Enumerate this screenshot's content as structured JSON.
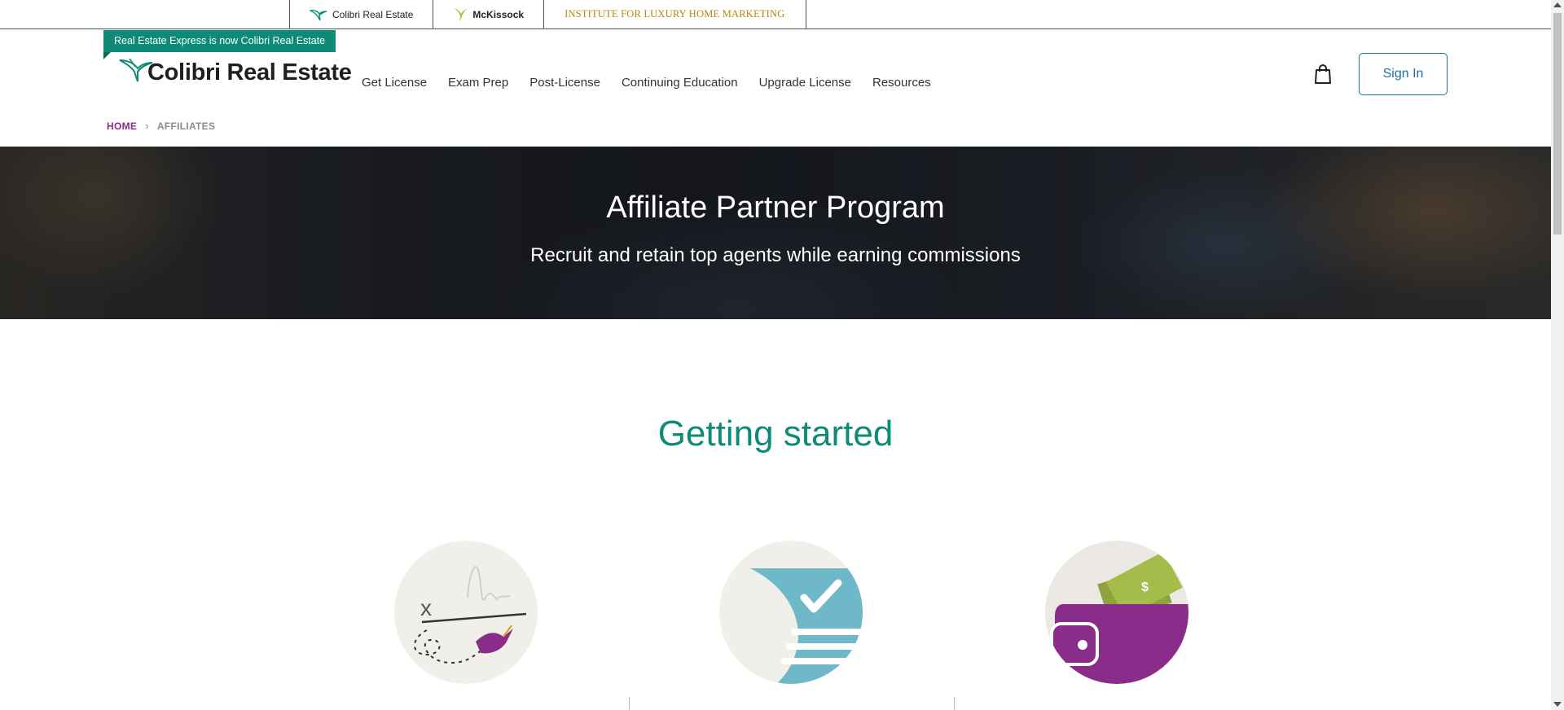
{
  "brandbar": {
    "tabs": [
      {
        "label": "Colibri Real Estate",
        "icon": "hummingbird-icon"
      },
      {
        "label": "McKissock",
        "icon": "mckissock-bird-icon"
      },
      {
        "label": "INSTITUTE FOR LUXURY HOME MARKETING"
      }
    ]
  },
  "header": {
    "promo": "Real Estate Express is now Colibri Real Estate",
    "logo_text": "Colibri Real Estate",
    "nav": [
      "Get License",
      "Exam Prep",
      "Post-License",
      "Continuing Education",
      "Upgrade License",
      "Resources"
    ],
    "cart_icon": "shopping-bag-icon",
    "signin_label": "Sign In"
  },
  "breadcrumb": {
    "home": "HOME",
    "current": "AFFILIATES"
  },
  "hero": {
    "title": "Affiliate Partner Program",
    "subtitle": "Recruit and retain top agents while earning commissions"
  },
  "getting_started": {
    "title": "Getting started",
    "steps": [
      {
        "icon": "signature-hummingbird-icon"
      },
      {
        "icon": "checklist-document-icon"
      },
      {
        "icon": "wallet-money-icon"
      }
    ]
  },
  "colors": {
    "teal": "#0d8b77",
    "purple": "#8a2c8a",
    "blue": "#1f6fa6",
    "gold": "#b8860b"
  }
}
